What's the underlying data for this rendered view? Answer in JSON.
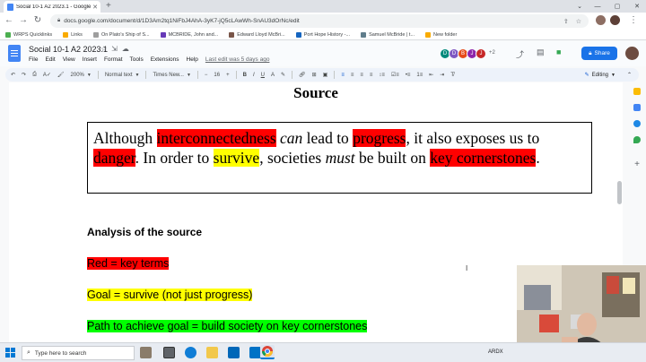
{
  "browser": {
    "tab_title": "Social 10-1 A2 2023.1 - Google D",
    "url": "docs.google.com/document/d/1D3Am2tq1NiFbJ4AhA-3yK7-jQ5cLAwWh-SnAU3dOrNc/edit",
    "bookmarks": [
      {
        "label": "WRPS Quicklinks",
        "icon": "bookmark-folder-icon",
        "color": "#4caf50"
      },
      {
        "label": "Links",
        "icon": "folder-icon",
        "color": "#f9ab00"
      },
      {
        "label": "On Plato's Ship of S...",
        "icon": "page-icon",
        "color": "#9e9e9e"
      },
      {
        "label": "MCBRIDE, John and...",
        "icon": "page-icon",
        "color": "#673ab7"
      },
      {
        "label": "Edward Lloyd McBri...",
        "icon": "page-icon",
        "color": "#795548"
      },
      {
        "label": "Port Hope History -...",
        "icon": "page-icon",
        "color": "#1565c0"
      },
      {
        "label": "Samuel McBride | t...",
        "icon": "page-icon",
        "color": "#607d8b"
      },
      {
        "label": "New folder",
        "icon": "folder-icon",
        "color": "#f9ab00"
      }
    ]
  },
  "docs": {
    "title": "Social 10-1 A2 2023.1",
    "menu": [
      "File",
      "Edit",
      "View",
      "Insert",
      "Format",
      "Tools",
      "Extensions",
      "Help"
    ],
    "last_edit": "Last edit was 5 days ago",
    "collaborators": [
      {
        "initial": "D",
        "color": "#00897b"
      },
      {
        "initial": "D",
        "color": "#7e57c2"
      },
      {
        "initial": "B",
        "color": "#e64a19"
      },
      {
        "initial": "J",
        "color": "#8e24aa"
      },
      {
        "initial": "J",
        "color": "#c62828"
      }
    ],
    "collaborators_more": "+2",
    "share_label": "Share",
    "toolbar": {
      "zoom": "200%",
      "style": "Normal text",
      "font": "Times New...",
      "size": "16",
      "mode": "Editing"
    }
  },
  "document": {
    "heading": "Source",
    "quote": {
      "t1": "Although ",
      "h1": "interconnectedness",
      "t2": " ",
      "i1": "can",
      "t3": " lead to ",
      "h2": "progress",
      "t4": ", it also exposes us to ",
      "h3": "danger",
      "t5": ".  In order to ",
      "h4": "survive",
      "t6": ", societies ",
      "i2": "must",
      "t7": " be built on ",
      "h5": "key cornerstones",
      "t8": "."
    },
    "analysis_heading": "Analysis of the source",
    "line_red": "Red = key terms",
    "line_goal": "Goal  = survive (not just progress)",
    "line_path": "Path to achieve goal = build society on key cornerstones"
  },
  "colors": {
    "red_highlight": "#ff0000",
    "yellow_highlight": "#ffff00",
    "green_highlight": "#00ff00",
    "share_blue": "#1a73e8"
  },
  "taskbar": {
    "search_placeholder": "Type here to search",
    "tray_text": "ARDX"
  }
}
